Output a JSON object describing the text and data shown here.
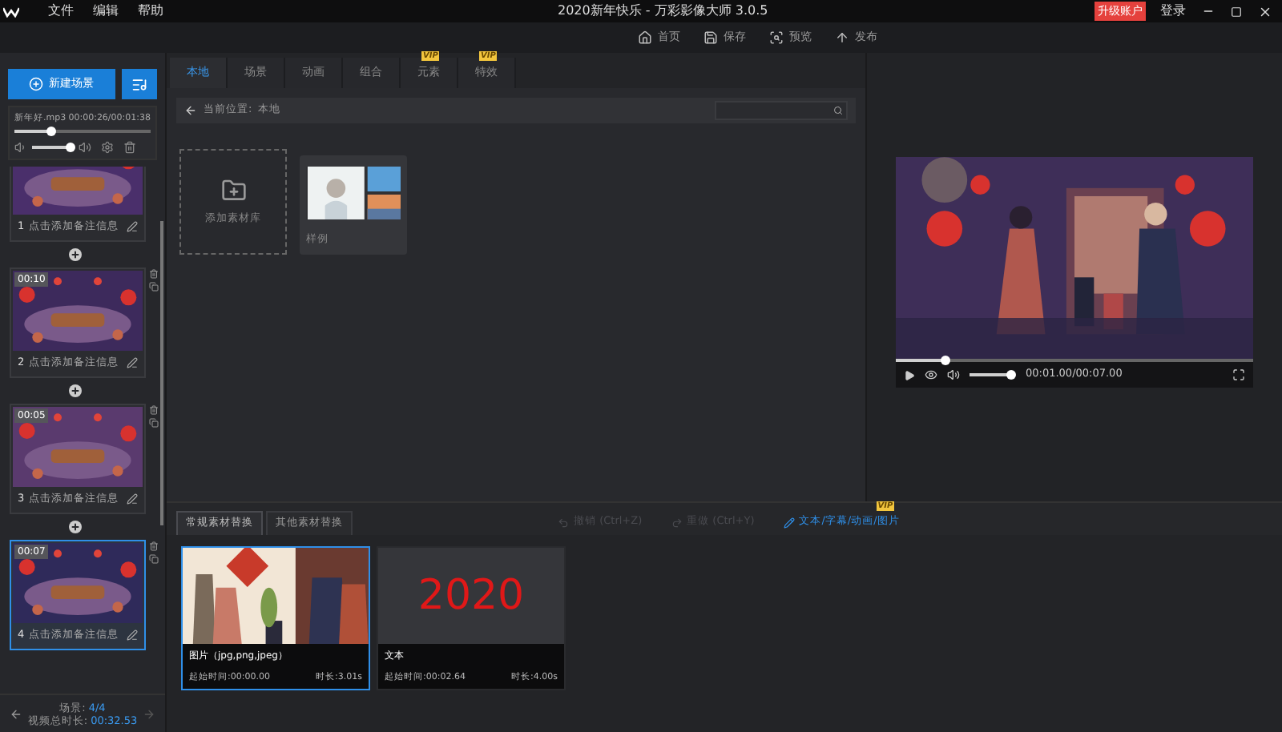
{
  "title_bar": {
    "menu": [
      "文件",
      "编辑",
      "帮助"
    ],
    "title": "2020新年快乐 - 万彩影像大师 3.0.5",
    "upgrade": "升级账户",
    "login": "登录"
  },
  "toolbar": [
    {
      "kind": "home",
      "label": "首页"
    },
    {
      "kind": "save",
      "label": "保存"
    },
    {
      "kind": "preview",
      "label": "预览"
    },
    {
      "kind": "publish",
      "label": "发布"
    }
  ],
  "sidebar": {
    "new_scene": "新建场景",
    "music": {
      "file": "新年好.mp3",
      "time": "00:00:26/00:01:38",
      "level": 0.27,
      "volume": {
        "level": 1
      }
    },
    "scenes": [
      {
        "number": "1",
        "note": "点击添加备注信息",
        "selected": false
      },
      {
        "number": "2",
        "badge": "00:10",
        "note": "点击添加备注信息",
        "selected": false
      },
      {
        "number": "3",
        "badge": "00:05",
        "note": "点击添加备注信息",
        "selected": false
      },
      {
        "number": "4",
        "badge": "00:07",
        "note": "点击添加备注信息",
        "selected": true
      }
    ],
    "footer": {
      "scene_label": "场景:",
      "scene_count": "4/4",
      "duration_label": "视频总时长:",
      "duration": "00:32.53"
    }
  },
  "library": {
    "tabs": [
      {
        "label": "本地",
        "selected": true
      },
      {
        "label": "场景",
        "selected": false
      },
      {
        "label": "动画",
        "selected": false
      },
      {
        "label": "组合",
        "selected": false
      },
      {
        "label": "元素",
        "selected": false,
        "badge": "VIP"
      },
      {
        "label": "特效",
        "selected": false,
        "badge": "VIP"
      }
    ],
    "path_label": "当前位置:",
    "path": "本地",
    "tiles": [
      {
        "kind": "add",
        "label": "添加素材库"
      },
      {
        "kind": "folder",
        "label": "样例"
      }
    ]
  },
  "preview": {
    "level": 0.14,
    "volume": {
      "level": 1
    },
    "time": "00:01.00/00:07.00"
  },
  "replace": {
    "tabs": [
      {
        "label": "常规素材替换",
        "selected": true
      },
      {
        "label": "其他素材替换",
        "selected": false
      }
    ],
    "undo": {
      "label": "撤销 (Ctrl+Z)",
      "disabled": true
    },
    "redo": {
      "label": "重做 (Ctrl+Y)",
      "disabled": true
    },
    "edit_link": {
      "label": "文本/字幕/动画/图片",
      "badge": "VIP"
    },
    "cards": [
      {
        "kind": "picture",
        "label": "图片（jpg,png,jpeg）",
        "start": "起始时间:00:00.00",
        "duration": "时长:3.01s",
        "selected": true
      },
      {
        "kind": "text",
        "text": "2020",
        "label": "文本",
        "start": "起始时间:00:02.64",
        "duration": "时长:4.00s",
        "selected": false
      }
    ]
  }
}
